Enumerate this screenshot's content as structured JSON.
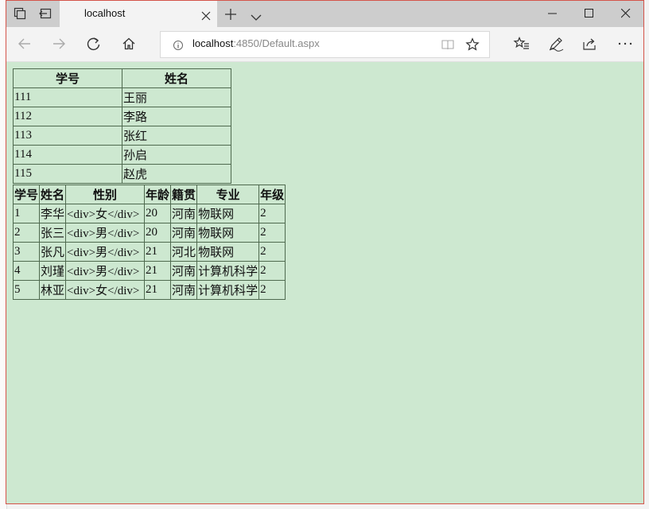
{
  "browser": {
    "tab": {
      "title": "localhost"
    },
    "address": {
      "host": "localhost",
      "path": ":4850/Default.aspx"
    }
  },
  "table1": {
    "headers": [
      "学号",
      "姓名"
    ],
    "rows": [
      [
        "111",
        "王丽"
      ],
      [
        "112",
        "李路"
      ],
      [
        "113",
        "张红"
      ],
      [
        "114",
        "孙启"
      ],
      [
        "115",
        "赵虎"
      ]
    ]
  },
  "table2": {
    "headers": [
      "学号",
      "姓名",
      "性别",
      "年龄",
      "籍贯",
      "专业",
      "年级"
    ],
    "rows": [
      [
        "1",
        "李华",
        "<div>女</div>",
        "20",
        "河南",
        "物联网",
        "2"
      ],
      [
        "2",
        "张三",
        "<div>男</div>",
        "20",
        "河南",
        "物联网",
        "2"
      ],
      [
        "3",
        "张凡",
        "<div>男</div>",
        "21",
        "河北",
        "物联网",
        "2"
      ],
      [
        "4",
        "刘瑾",
        "<div>男</div>",
        "21",
        "河南",
        "计算机科学",
        "2"
      ],
      [
        "5",
        "林亚",
        "<div>女</div>",
        "21",
        "河南",
        "计算机科学",
        "2"
      ]
    ]
  },
  "colors": {
    "page_background": "#cde8d0",
    "window_border": "#d4544a",
    "tabbar": "#cdcdcd"
  }
}
